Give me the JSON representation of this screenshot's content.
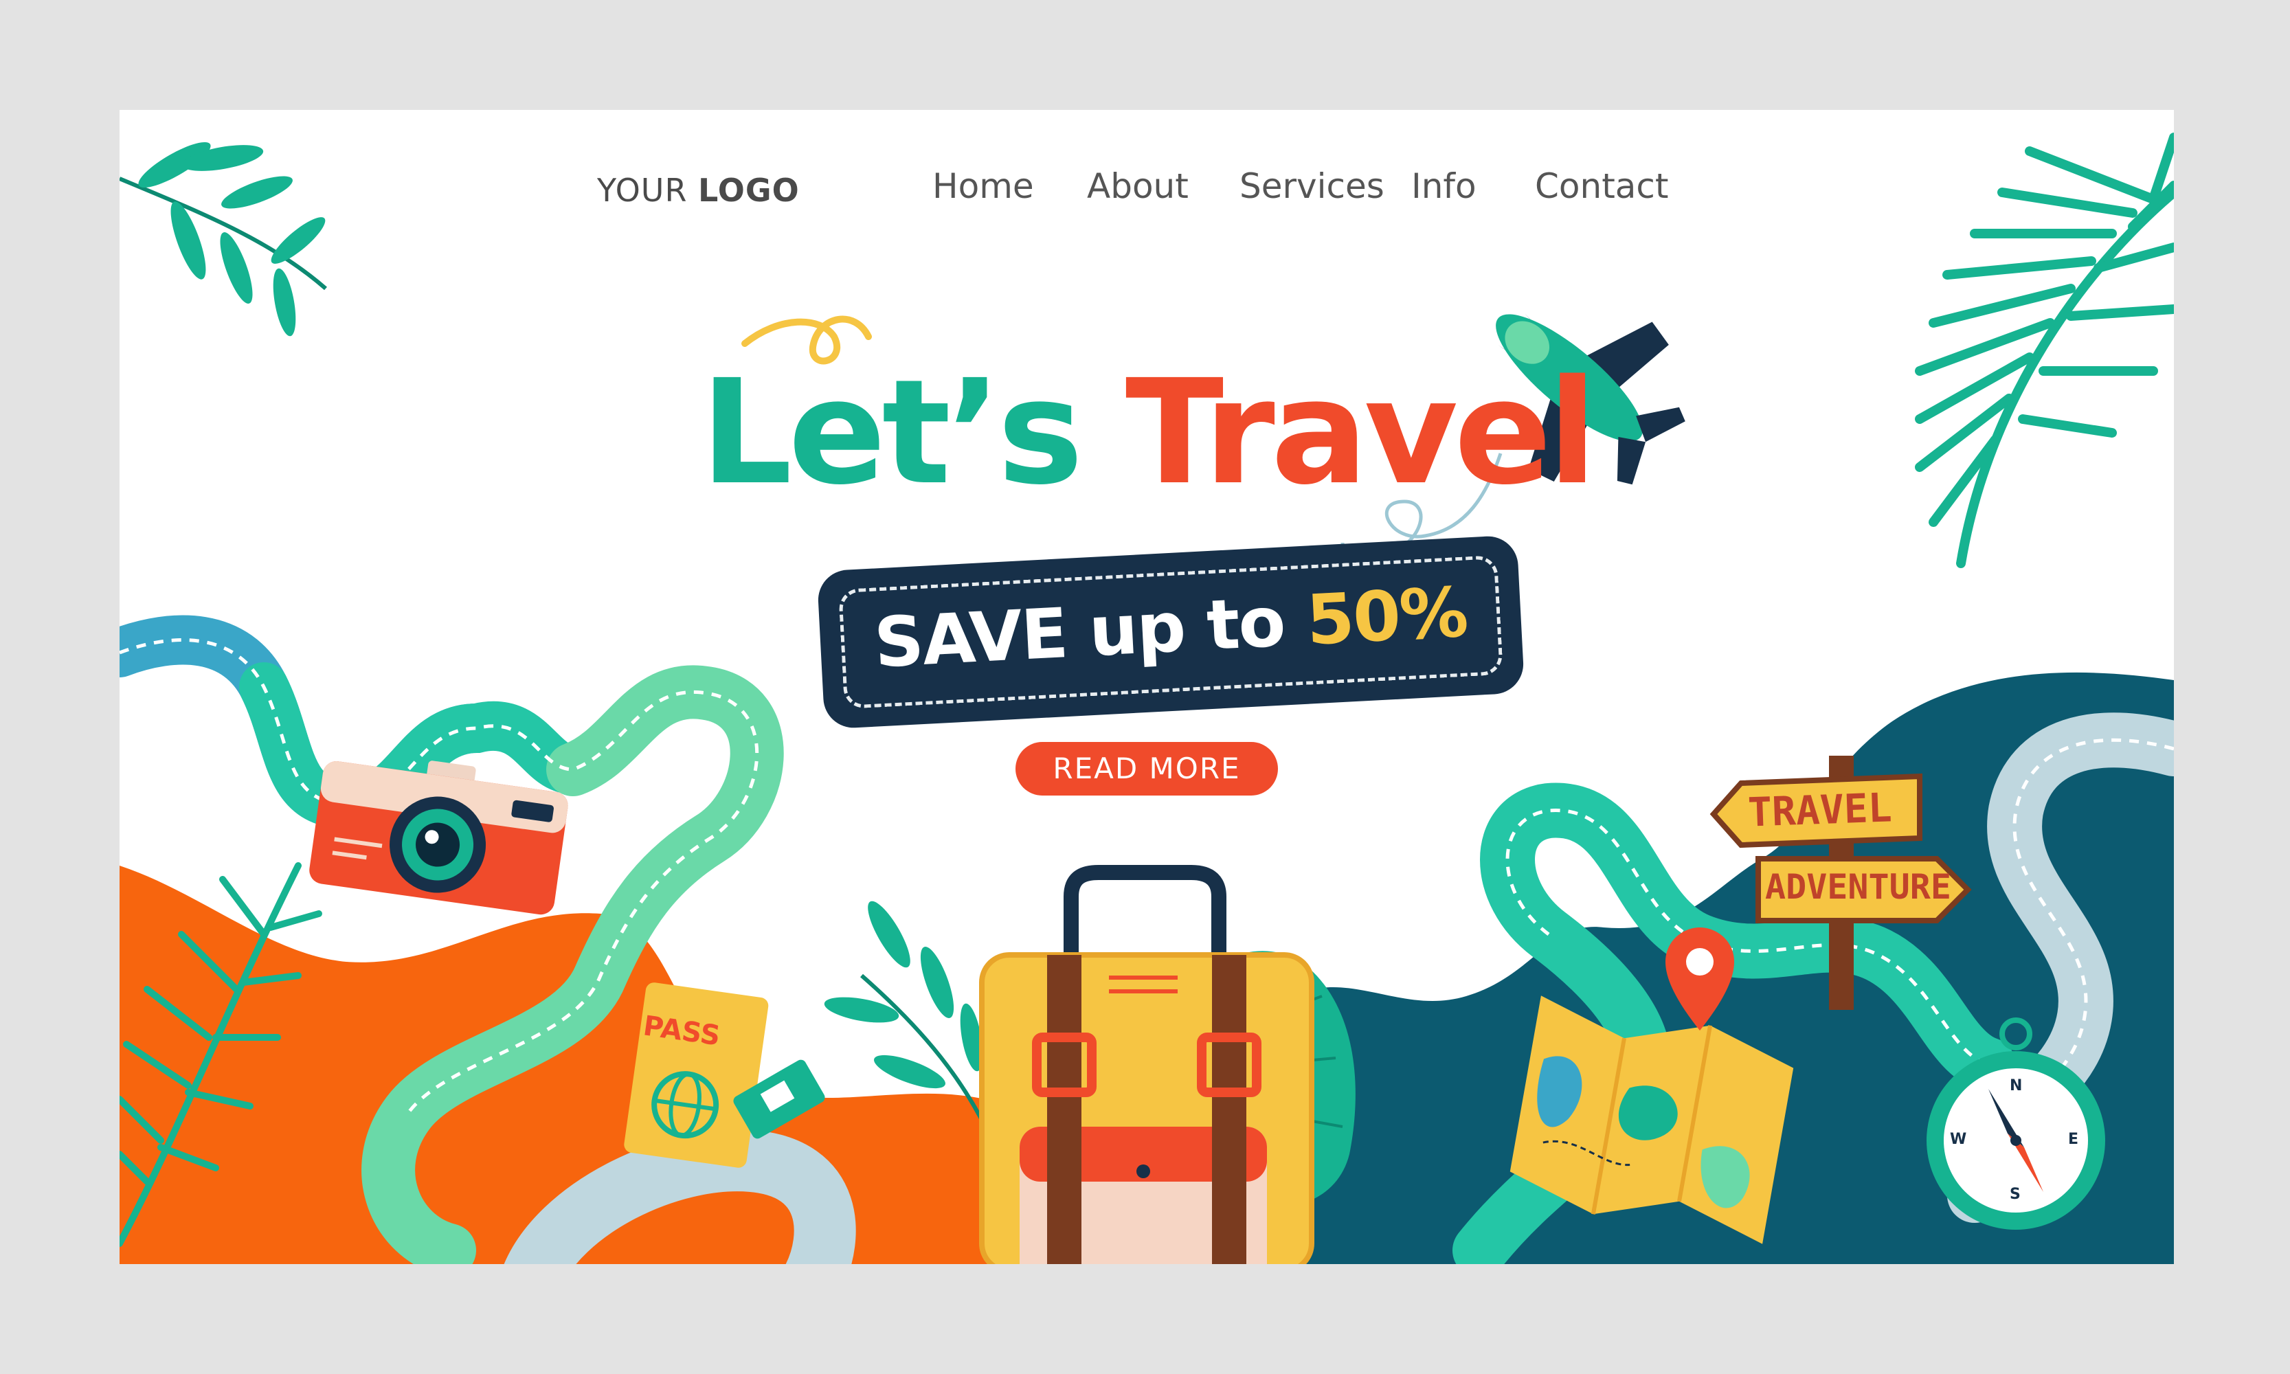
{
  "header": {
    "logo": {
      "light": "YOUR",
      "bold": "LOGO"
    },
    "nav": [
      "Home",
      "About",
      "Services",
      "Info",
      "Contact"
    ]
  },
  "hero": {
    "headline_part1": "Let’s",
    "headline_part2": "Travel",
    "promo_text": "SAVE up to",
    "promo_percent": "50%",
    "cta_label": "READ MORE"
  },
  "illustration": {
    "sign_top": "TRAVEL",
    "sign_bottom": "ADVENTURE",
    "passport_label": "PASS",
    "compass_points": [
      "N",
      "E",
      "S",
      "W"
    ]
  },
  "colors": {
    "teal": "#16b391",
    "coral": "#f04b2b",
    "navy": "#173049",
    "yellow": "#f6c543",
    "orange": "#f7650e",
    "deep_teal": "#0c5a70"
  }
}
